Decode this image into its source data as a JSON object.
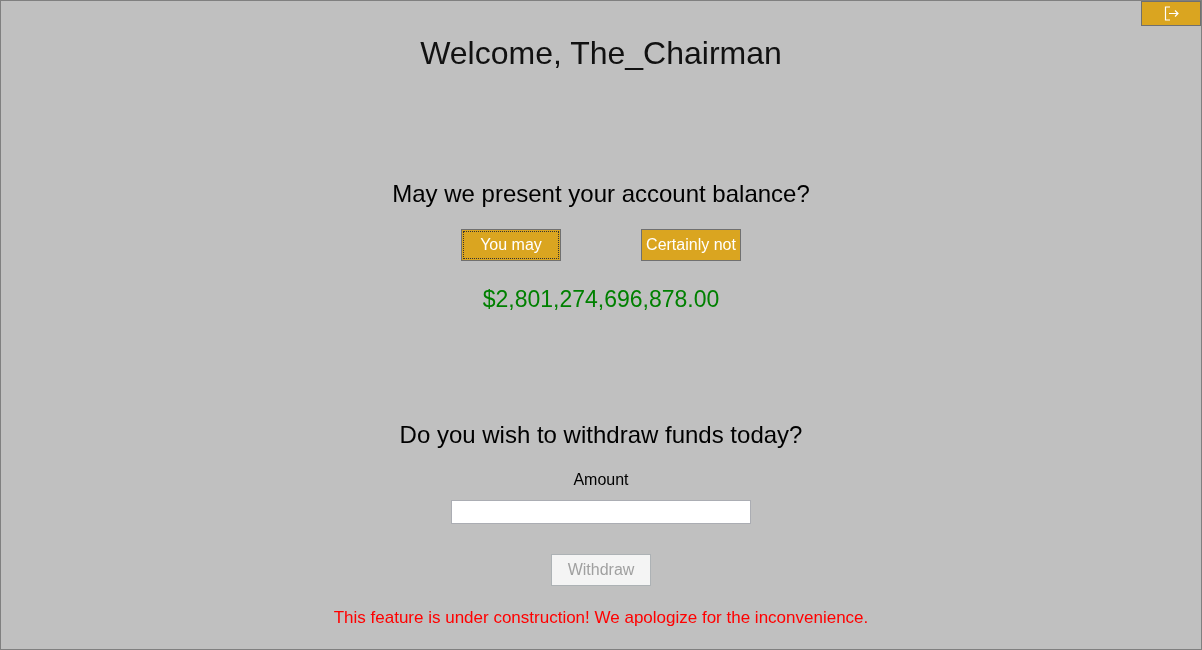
{
  "window": {
    "title": "Welcome, The_Chairman"
  },
  "balance_section": {
    "question": "May we present your account balance?",
    "buttons": [
      {
        "label": "You may",
        "focused": true,
        "disabled": false
      },
      {
        "label": "Certainly not",
        "focused": false,
        "disabled": false
      }
    ],
    "balance": "$2,801,274,696,878.00"
  },
  "withdraw_section": {
    "question": "Do you wish to withdraw funds today?",
    "amount_label": "Amount",
    "button": {
      "label": "Withdraw",
      "disabled": true,
      "focused": false
    },
    "notice": "This feature is under construction! We apologize for the inconvenience."
  }
}
